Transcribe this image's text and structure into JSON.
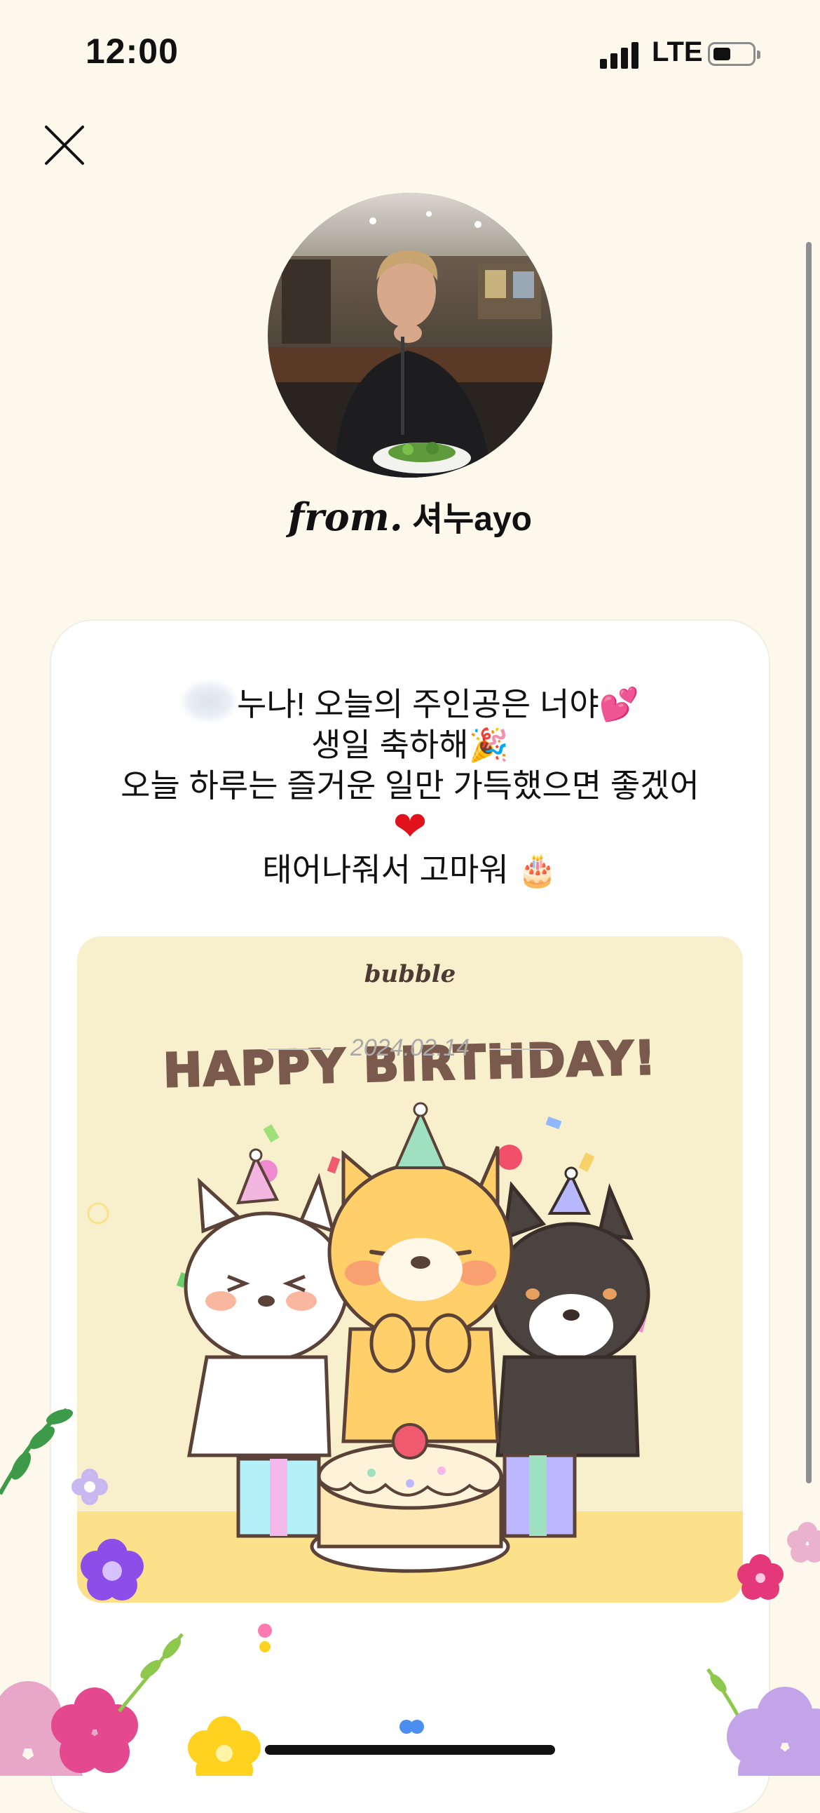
{
  "status_bar": {
    "time": "12:00",
    "network": "LTE",
    "signal_bars": 4,
    "battery_level": 0.35
  },
  "header": {
    "close_icon": "close-icon"
  },
  "profile": {
    "from_prefix": "from.",
    "sender_name": "셔누ayo"
  },
  "letter": {
    "lines": [
      "누나! 오늘의 주인공은 너야",
      "생일 축하해",
      "오늘 하루는 즐거운 일만 가득했으면 좋겠어",
      "태어나줘서 고마워"
    ],
    "emojis": {
      "line1": "💕",
      "line2": "🎉",
      "line3": "❤",
      "line4": "🎂"
    }
  },
  "birthday_card": {
    "brand": "bubble",
    "headline": "HAPPY BIRTHDAY!"
  },
  "footer": {
    "date": "2024.02.14"
  },
  "colors": {
    "background": "#fcf8ec",
    "card_background": "#ffffff",
    "birthday_card_background": "#f8f0cd",
    "headline_brown": "#7a5a4c",
    "date_gray": "#a9a9a9"
  }
}
